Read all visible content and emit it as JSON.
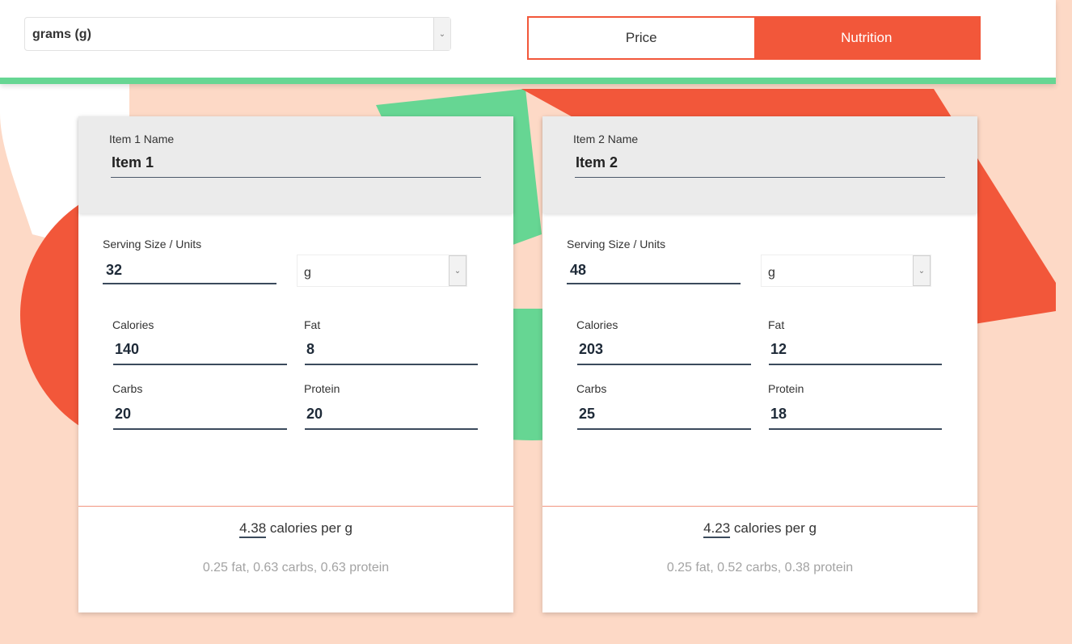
{
  "header": {
    "unit_select": {
      "value": "grams (g)",
      "icon": "chevron-down-icon"
    },
    "mode_toggle": {
      "price_label": "Price",
      "nutrition_label": "Nutrition",
      "active": "Nutrition"
    }
  },
  "colors": {
    "accent_orange": "#f2573a",
    "accent_green": "#66d693",
    "background_peach": "#fdd9c6"
  },
  "items": [
    {
      "name_label": "Item 1 Name",
      "name": "Item 1",
      "serving_label": "Serving Size / Units",
      "serving": "32",
      "unit": "g",
      "calories_label": "Calories",
      "calories": "140",
      "fat_label": "Fat",
      "fat": "8",
      "carbs_label": "Carbs",
      "carbs": "20",
      "protein_label": "Protein",
      "protein": "20",
      "per_value": "4.38",
      "per_text": " calories per g",
      "macros": "0.25 fat, 0.63 carbs, 0.63 protein"
    },
    {
      "name_label": "Item 2 Name",
      "name": "Item 2",
      "serving_label": "Serving Size / Units",
      "serving": "48",
      "unit": "g",
      "calories_label": "Calories",
      "calories": "203",
      "fat_label": "Fat",
      "fat": "12",
      "carbs_label": "Carbs",
      "carbs": "25",
      "protein_label": "Protein",
      "protein": "18",
      "per_value": "4.23",
      "per_text": " calories per g",
      "macros": "0.25 fat, 0.52 carbs, 0.38 protein"
    }
  ]
}
